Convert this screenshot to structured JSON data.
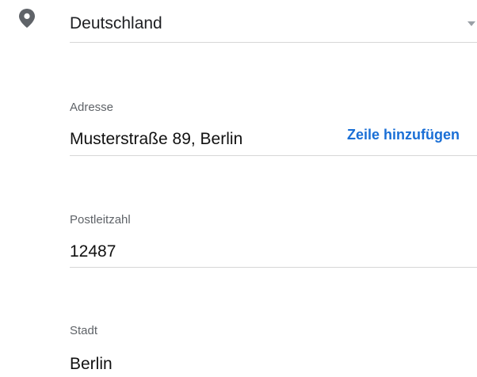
{
  "country": {
    "value": "Deutschland"
  },
  "address": {
    "label": "Adresse",
    "value": "Musterstraße 89, Berlin",
    "add_line_label": "Zeile hinzufügen"
  },
  "postal_code": {
    "label": "Postleitzahl",
    "value": "12487"
  },
  "city": {
    "label": "Stadt",
    "value": "Berlin"
  },
  "colors": {
    "accent": "#1a6fd6",
    "icon": "#5f6368",
    "divider": "#d6d6d6"
  },
  "icons": {
    "location": "location-pin-icon",
    "dropdown": "dropdown-caret-icon"
  }
}
